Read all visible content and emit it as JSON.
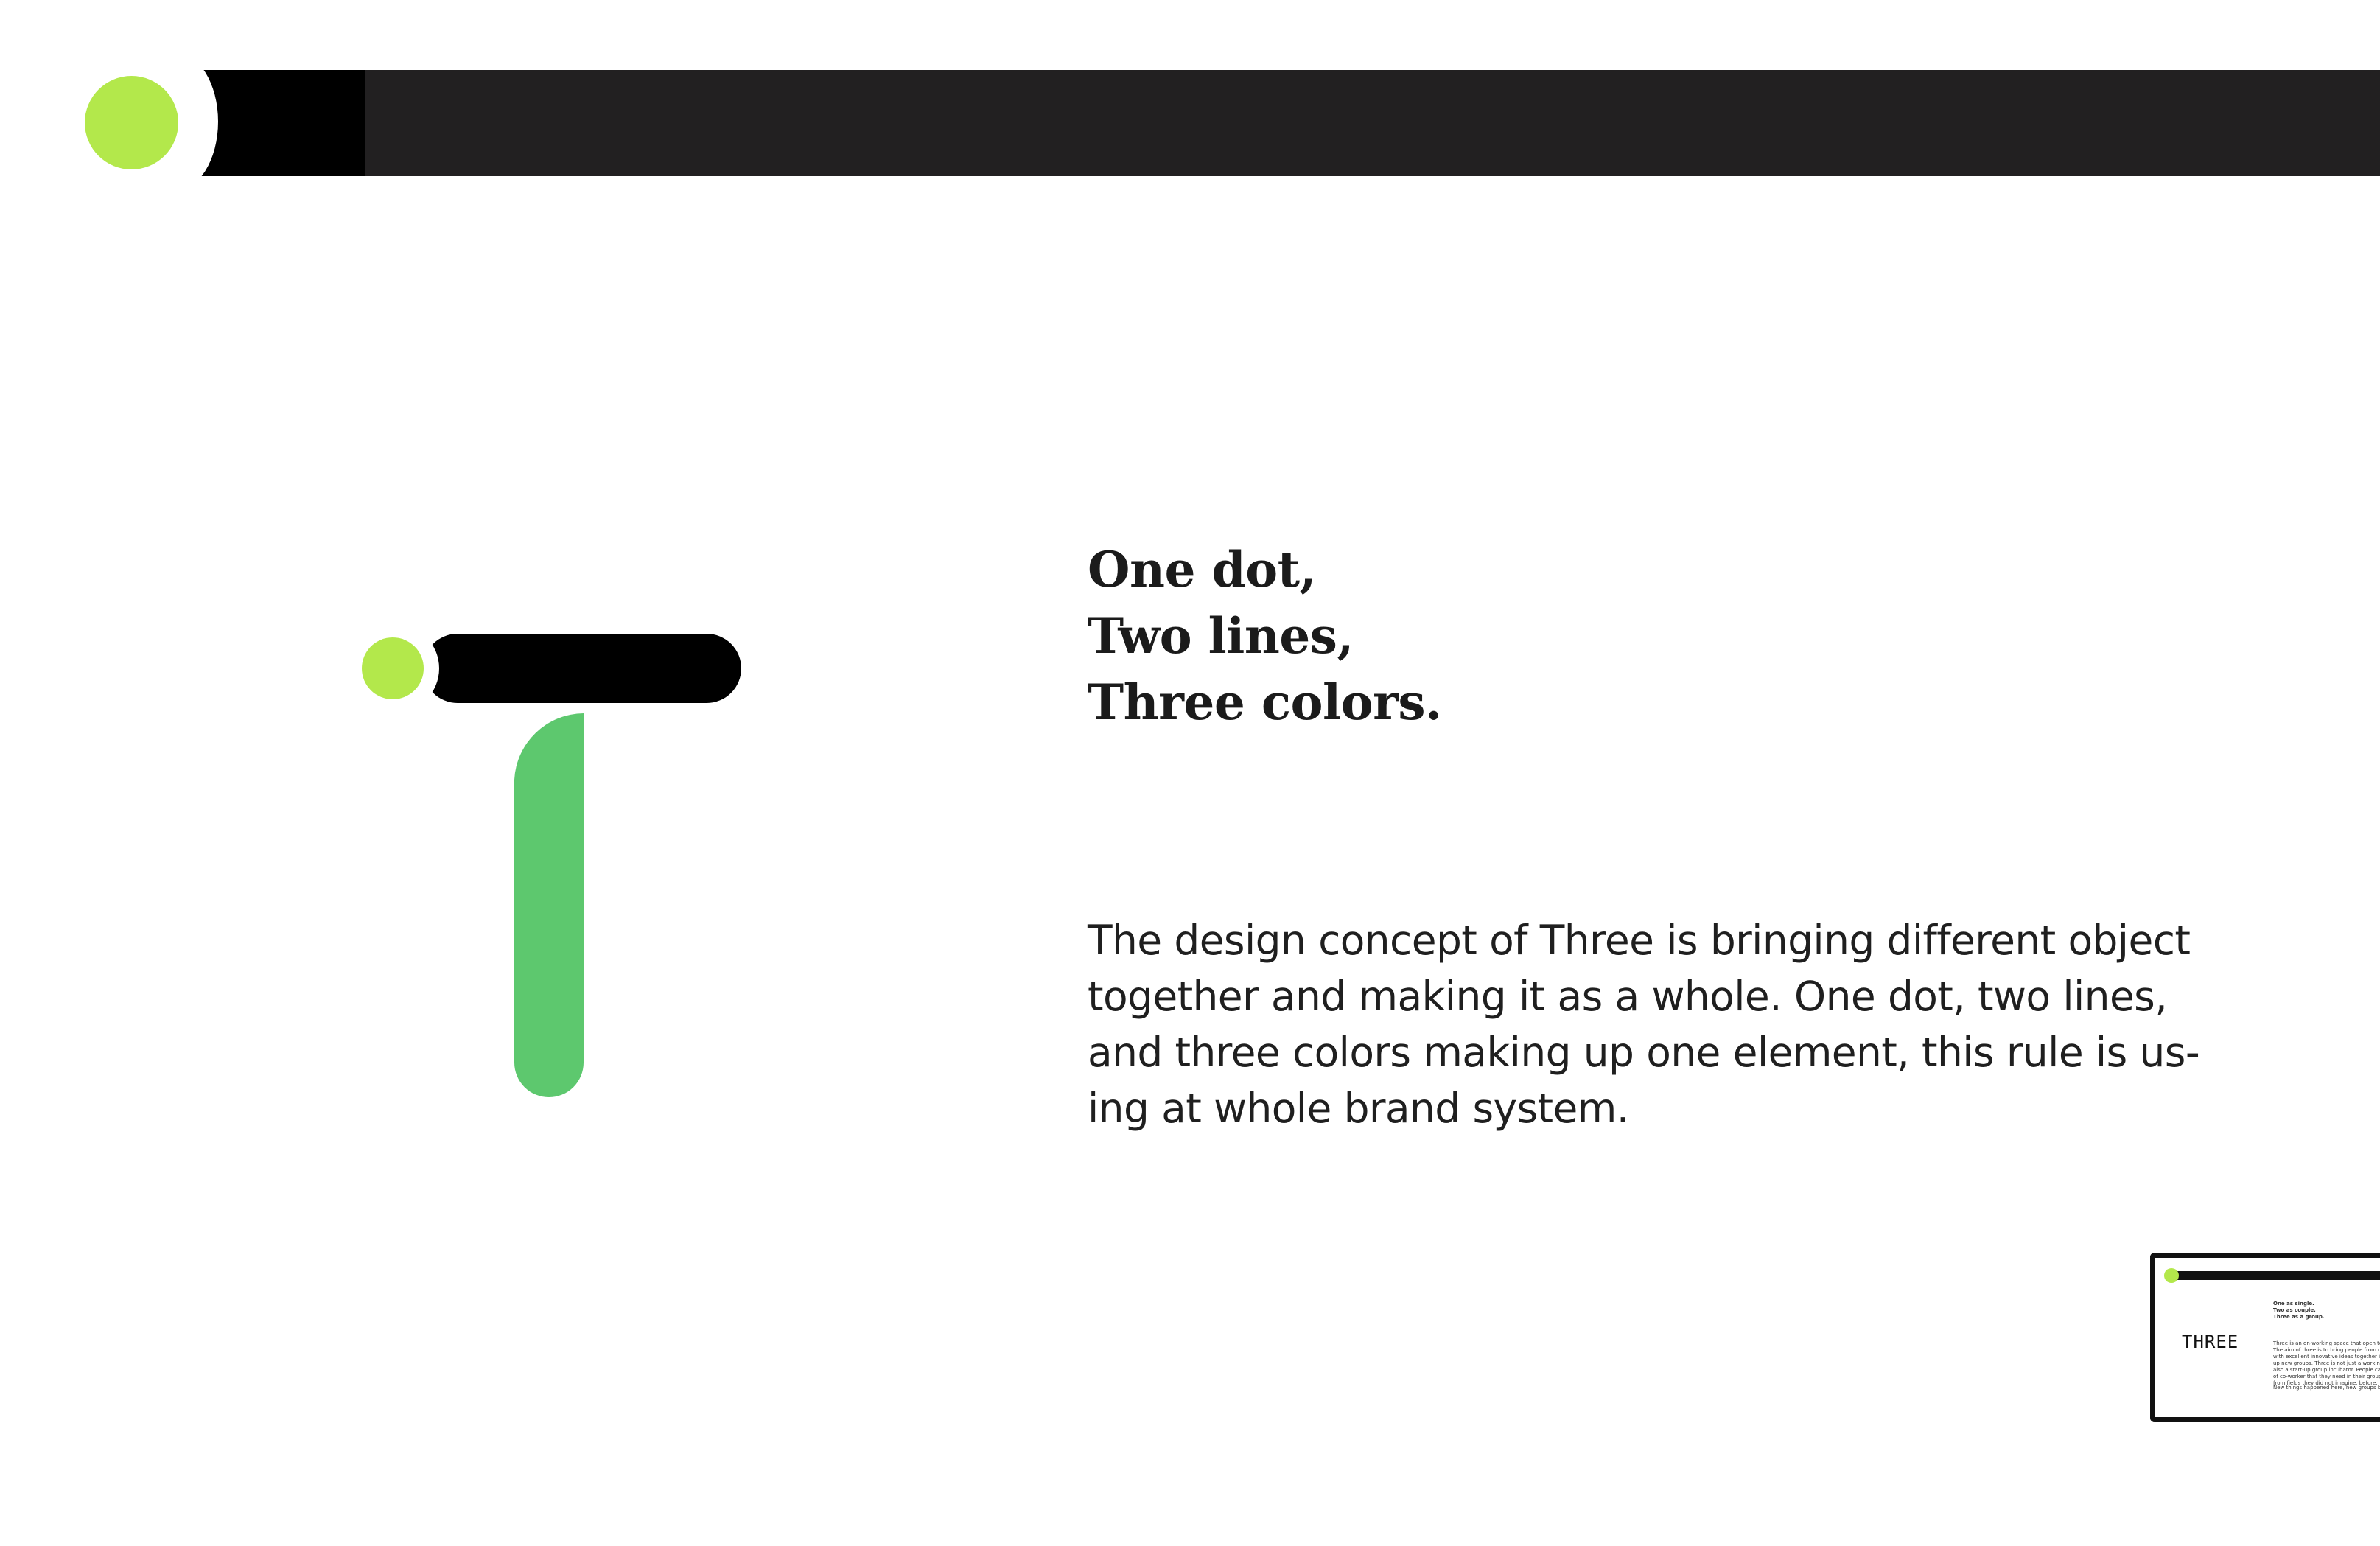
{
  "colors": {
    "accent_lime": "#b3e84b",
    "accent_green": "#5dc86e",
    "bar_black": "#000000",
    "bar_dark": "#222021"
  },
  "headline": {
    "lines": [
      "One dot,",
      "Two lines,",
      "Three colors."
    ]
  },
  "description": {
    "lines": [
      "The design concept of Three is bringing different object",
      "together and making it as a whole. One dot, two lines,",
      "and three colors making up one element, this rule is us-",
      "ing at whole brand system."
    ]
  },
  "thumbnail": {
    "wordmark": "THREE",
    "heading_lines": [
      "One as single.",
      "Two as couple.",
      "Three as a group."
    ],
    "body_lines": [
      "Three is an on-working space that open to the public.",
      "The aim of three is to bring people from different fields",
      "with excellent innovative ideas together in order to make",
      "up new groups. Three is not just a working place, but",
      "also a start-up group incubator. People can find the dream",
      "of co-worker that they need in their group, even complete",
      "from fields they did not imagine, before."
    ],
    "footer_line": "New things happened here, new groups born here."
  }
}
